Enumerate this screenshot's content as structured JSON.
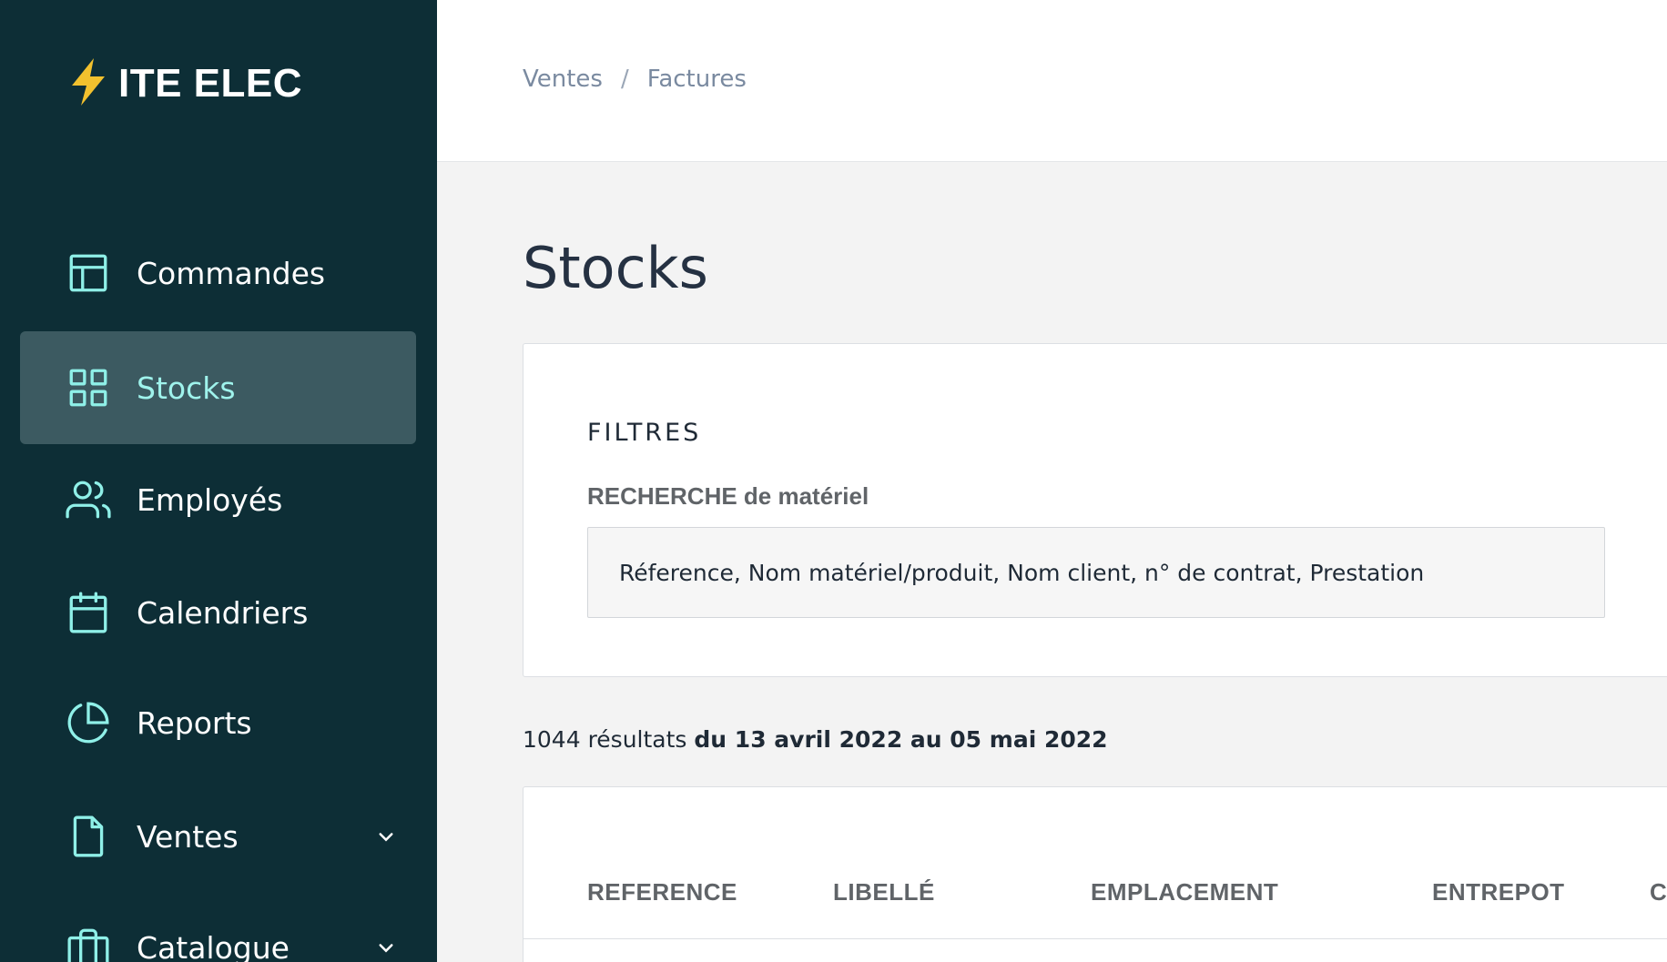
{
  "brand": {
    "name": "ITE ELEC",
    "icon": "lightning-bolt-icon",
    "accent": "#f2c12e"
  },
  "sidebar": {
    "items": [
      {
        "label": "Commandes",
        "icon": "layout-icon",
        "active": false
      },
      {
        "label": "Stocks",
        "icon": "grid-icon",
        "active": true
      },
      {
        "label": "Employés",
        "icon": "users-icon",
        "active": false
      },
      {
        "label": "Calendriers",
        "icon": "calendar-icon",
        "active": false
      },
      {
        "label": "Reports",
        "icon": "pie-chart-icon",
        "active": false
      },
      {
        "label": "Ventes",
        "icon": "file-icon",
        "active": false,
        "expandable": true
      },
      {
        "label": "Catalogue",
        "icon": "briefcase-icon",
        "active": false,
        "expandable": true
      }
    ]
  },
  "header": {
    "breadcrumb": [
      "Ventes",
      "Factures"
    ],
    "separator": "/"
  },
  "main": {
    "title": "Stocks",
    "filters": {
      "title": "FILTRES",
      "search_label": "RECHERCHE de matériel",
      "search_placeholder": "Réference, Nom matériel/produit, Nom client, n° de contrat, Prestation"
    },
    "results": {
      "count_text": "1044 résultats",
      "range_text": "du 13 avril 2022 au 05 mai 2022"
    },
    "table": {
      "columns": [
        "REFERENCE",
        "LIBELLÉ",
        "EMPLACEMENT",
        "ENTREPOT",
        "C"
      ]
    }
  },
  "colors": {
    "sidebar_bg": "#0d2e36",
    "sidebar_active_bg": "#3c5a61",
    "icon_color": "#8ff0e8",
    "active_label": "#9ff3ec"
  }
}
